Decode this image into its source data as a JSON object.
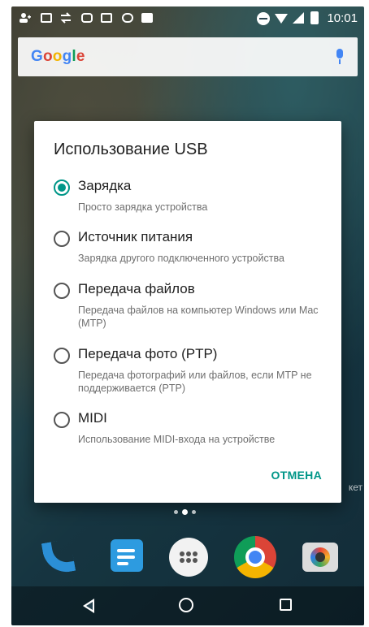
{
  "status_bar": {
    "time": "10:01",
    "icons": [
      "person-plus-icon",
      "mail-icon",
      "swap-icon",
      "instagram-icon",
      "chat-icon",
      "bug-icon",
      "bag-icon",
      "do-not-disturb-icon",
      "wifi-icon",
      "signal-icon",
      "battery-icon"
    ]
  },
  "search": {
    "logo_letters": [
      "G",
      "o",
      "o",
      "g",
      "l",
      "e"
    ],
    "logo_colors": [
      "#4285f4",
      "#db4437",
      "#f4b400",
      "#4285f4",
      "#0f9d58",
      "#db4437"
    ],
    "mic_icon": "mic-icon"
  },
  "dialog": {
    "title": "Использование USB",
    "options": [
      {
        "label": "Зарядка",
        "description": "Просто зарядка устройства",
        "checked": true
      },
      {
        "label": "Источник питания",
        "description": "Зарядка другого подключенного устройства",
        "checked": false
      },
      {
        "label": "Передача файлов",
        "description": "Передача файлов на компьютер Windows или Mac (MTP)",
        "checked": false
      },
      {
        "label": "Передача фото (PTP)",
        "description": "Передача фотографий или файлов, если MTP не поддерживается (PTP)",
        "checked": false
      },
      {
        "label": "MIDI",
        "description": "Использование MIDI-входа на устройстве",
        "checked": false
      }
    ],
    "cancel_label": "ОТМЕНА",
    "accent_color": "#009688"
  },
  "home": {
    "side_text": "кет"
  },
  "dock": [
    "phone-icon",
    "messages-icon",
    "apps-icon",
    "chrome-icon",
    "camera-icon"
  ],
  "nav": [
    "back-icon",
    "home-icon",
    "recents-icon"
  ]
}
